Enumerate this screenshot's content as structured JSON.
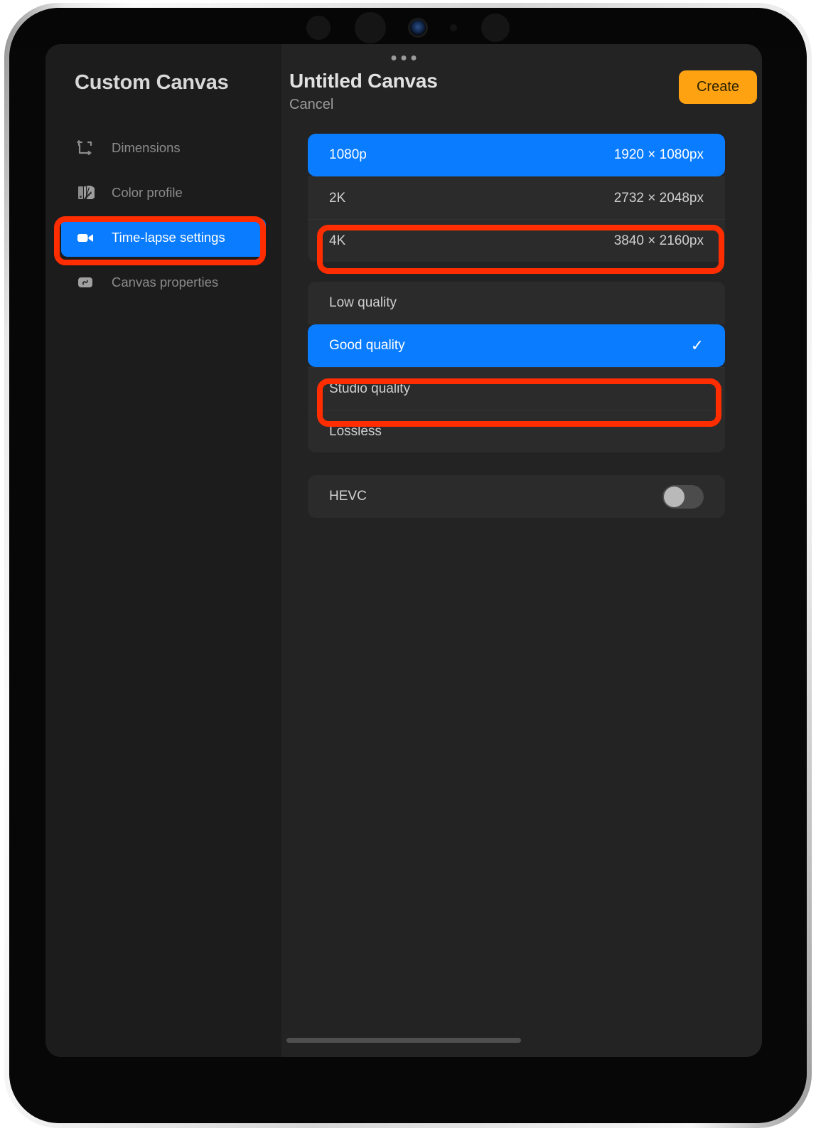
{
  "device": {
    "frame": "ipad",
    "camera_icons": [
      "sensor-dot",
      "sensor-dot",
      "front-camera-lens",
      "ambient-sensor",
      "sensor-dot"
    ]
  },
  "app": {
    "drag_handle_icon": "drag-handle-dots-icon"
  },
  "sidebar": {
    "title": "Custom Canvas",
    "items": [
      {
        "label": "Dimensions",
        "icon": "dimensions-icon",
        "active": false
      },
      {
        "label": "Color profile",
        "icon": "color-profile-icon",
        "active": false
      },
      {
        "label": "Time-lapse settings",
        "icon": "video-camera-icon",
        "active": true
      },
      {
        "label": "Canvas properties",
        "icon": "canvas-properties-icon",
        "active": false
      }
    ]
  },
  "main": {
    "doc_title": "Untitled Canvas",
    "cancel_label": "Cancel",
    "create_label": "Create",
    "resolution_group": [
      {
        "label": "1080p",
        "value": "1920 × 1080px",
        "selected": true
      },
      {
        "label": "2K",
        "value": "2732 × 2048px",
        "selected": false
      },
      {
        "label": "4K",
        "value": "3840 × 2160px",
        "selected": false
      }
    ],
    "quality_group": [
      {
        "label": "Low quality",
        "selected": false,
        "check": ""
      },
      {
        "label": "Good quality",
        "selected": true,
        "check": "✓"
      },
      {
        "label": "Studio quality",
        "selected": false,
        "check": ""
      },
      {
        "label": "Lossless",
        "selected": false,
        "check": ""
      }
    ],
    "codec_row": {
      "label": "HEVC",
      "toggle_state": "off"
    }
  },
  "annotations": {
    "color": "#ff2d00",
    "boxes": [
      {
        "target": "sidebar-item-time-lapse-settings"
      },
      {
        "target": "resolution-row-4k"
      },
      {
        "target": "quality-row-studio-quality"
      }
    ]
  },
  "colors": {
    "accent_blue": "#0a7cff",
    "accent_orange": "#ffa211",
    "panel_bg": "#232323",
    "sidebar_bg": "#1c1c1c",
    "row_bg": "#2b2b2b",
    "annotation_red": "#ff2d00"
  }
}
